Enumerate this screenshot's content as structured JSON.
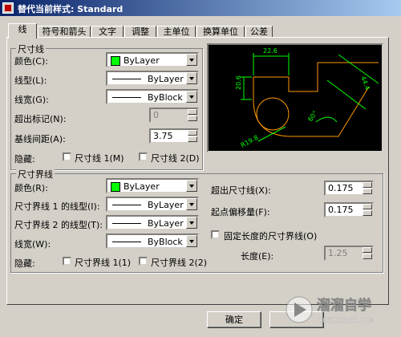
{
  "window": {
    "title": "替代当前样式: Standard"
  },
  "tabs": [
    "线",
    "符号和箭头",
    "文字",
    "调整",
    "主单位",
    "换算单位",
    "公差"
  ],
  "dim_lines": {
    "title": "尺寸线",
    "color_label": "颜色(C):",
    "color_value": "ByLayer",
    "linetype_label": "线型(L):",
    "linetype_value": "ByLayer",
    "lineweight_label": "线宽(G):",
    "lineweight_value": "ByBlock",
    "extend_label": "超出标记(N):",
    "extend_value": "0",
    "baseline_label": "基线间距(A):",
    "baseline_value": "3.75",
    "suppress_label": "隐藏:",
    "suppress1": "尺寸线 1(M)",
    "suppress2": "尺寸线 2(D)"
  },
  "ext_lines": {
    "title": "尺寸界线",
    "color_label": "颜色(R):",
    "color_value": "ByLayer",
    "lt1_label": "尺寸界线 1 的线型(I):",
    "lt1_value": "ByLayer",
    "lt2_label": "尺寸界线 2 的线型(T):",
    "lt2_value": "ByLayer",
    "lineweight_label": "线宽(W):",
    "lineweight_value": "ByBlock",
    "suppress_label": "隐藏:",
    "suppress1": "尺寸界线 1(1)",
    "suppress2": "尺寸界线 2(2)",
    "beyond_label": "超出尺寸线(X):",
    "beyond_value": "0.175",
    "offset_label": "起点偏移量(F):",
    "offset_value": "0.175",
    "fixed_label": "固定长度的尺寸界线(O)",
    "length_label": "长度(E):",
    "length_value": "1.25"
  },
  "preview": {
    "dim_top": "22.6",
    "dim_left": "20.6",
    "dim_right": "44.4",
    "dim_angle": "60°",
    "dim_radius": "R19.8"
  },
  "buttons": {
    "ok": "确定"
  },
  "watermark": {
    "brand": "溜溜自学",
    "url": "ZIXUE.3D66.COM"
  },
  "colors": {
    "swatch": "#00ff00",
    "preview_geometry": "#ff9900",
    "preview_dims": "#00ff00"
  }
}
